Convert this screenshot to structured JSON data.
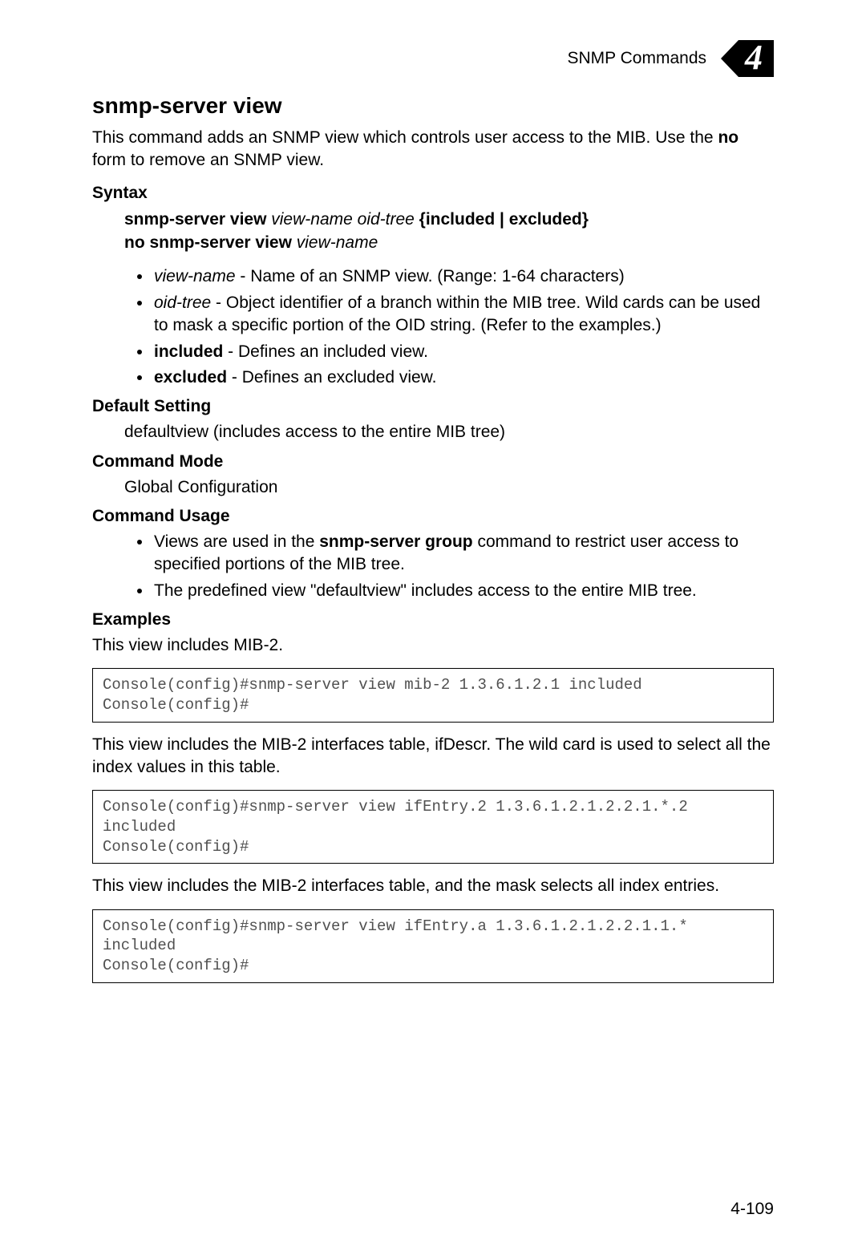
{
  "header": {
    "section": "SNMP Commands",
    "chapter": "4"
  },
  "title": "snmp-server view",
  "intro_part1": "This command adds an SNMP view which controls user access to the MIB. Use the ",
  "intro_bold": "no",
  "intro_part2": " form to remove an SNMP view.",
  "syntax": {
    "heading": "Syntax",
    "line1_b1": "snmp-server view ",
    "line1_i1": "view-name oid-tree ",
    "line1_b2": "{included | excluded}",
    "line2_b1": "no snmp-server view ",
    "line2_i1": "view-name",
    "params": {
      "p1_i": "view-name",
      "p1_t": " - Name of an SNMP view. (Range: 1-64 characters)",
      "p2_i": "oid-tree",
      "p2_t": " - Object identifier of a branch within the MIB tree. Wild cards can be used to mask a specific portion of the OID string. (Refer to the examples.)",
      "p3_b": "included",
      "p3_t": " - Defines an included view.",
      "p4_b": "excluded",
      "p4_t": " - Defines an excluded view."
    }
  },
  "default_setting": {
    "heading": "Default Setting",
    "text": "defaultview (includes access to the entire MIB tree)"
  },
  "command_mode": {
    "heading": "Command Mode",
    "text": "Global Configuration"
  },
  "command_usage": {
    "heading": "Command Usage",
    "u1_pre": "Views are used in the ",
    "u1_b": "snmp-server group",
    "u1_post": " command to restrict user access to specified portions of the MIB tree.",
    "u2": "The predefined view \"defaultview\" includes access to the entire MIB tree."
  },
  "examples": {
    "heading": "Examples",
    "intro1": "This view includes MIB-2.",
    "code1": "Console(config)#snmp-server view mib-2 1.3.6.1.2.1 included\nConsole(config)#",
    "intro2": "This view includes the MIB-2 interfaces table, ifDescr. The wild card is used to select all the index values in this table.",
    "code2": "Console(config)#snmp-server view ifEntry.2 1.3.6.1.2.1.2.2.1.*.2 included\nConsole(config)#",
    "intro3": "This view includes the MIB-2 interfaces table, and the mask selects all index entries.",
    "code3": "Console(config)#snmp-server view ifEntry.a 1.3.6.1.2.1.2.2.1.1.* included\nConsole(config)#"
  },
  "page_number": "4-109"
}
